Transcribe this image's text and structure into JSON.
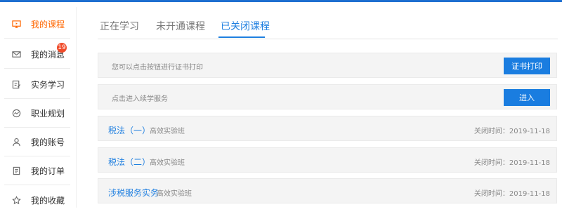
{
  "sidebar": {
    "items": [
      {
        "label": "我的课程",
        "icon": "monitor-icon",
        "active": true
      },
      {
        "label": "我的消息",
        "icon": "mail-icon",
        "badge": "19"
      },
      {
        "label": "实务学习",
        "icon": "edit-icon"
      },
      {
        "label": "职业规划",
        "icon": "chart-circle-icon"
      },
      {
        "label": "我的账号",
        "icon": "user-icon"
      },
      {
        "label": "我的订单",
        "icon": "document-icon"
      },
      {
        "label": "我的收藏",
        "icon": "star-icon"
      }
    ]
  },
  "tabs": [
    {
      "label": "正在学习"
    },
    {
      "label": "未开通课程"
    },
    {
      "label": "已关闭课程",
      "active": true
    }
  ],
  "certificate": {
    "hint": "您可以点击按钮进行证书打印",
    "button": "证书打印"
  },
  "renewal": {
    "hint": "点击进入续学服务",
    "button": "进入"
  },
  "courses": [
    {
      "title": "税法（一）",
      "class": "高效实验班",
      "closed": "关闭时间：2019-11-18"
    },
    {
      "title": "税法（二）",
      "class": "高效实验班",
      "closed": "关闭时间：2019-11-18"
    },
    {
      "title": "涉税服务实务",
      "class": "高效实验班",
      "closed": "关闭时间：2019-11-18"
    }
  ],
  "colors": {
    "accent": "#1f7fe0",
    "active_sidebar": "#ff6600",
    "badge": "#f04b2a"
  }
}
